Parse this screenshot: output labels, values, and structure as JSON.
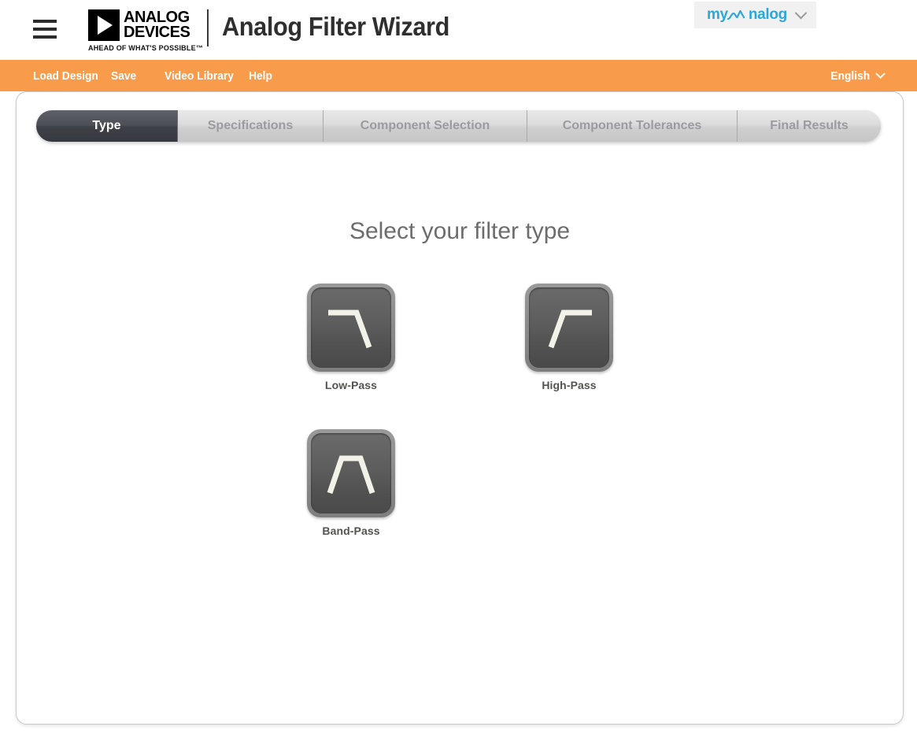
{
  "header": {
    "menu_icon": "hamburger-menu-icon",
    "brand": {
      "line1": "ANALOG",
      "line2": "DEVICES",
      "tagline": "AHEAD OF WHAT'S POSSIBLE™"
    },
    "app_title": "Analog Filter Wizard",
    "account": {
      "label_pre": "my",
      "label_post": "nalog",
      "full_label": "myAnalog",
      "chevron": "chevron-down-icon"
    }
  },
  "menubar": {
    "background": "#f89b4b",
    "items": [
      {
        "label": "Load Design",
        "name": "load-design"
      },
      {
        "label": "Save",
        "name": "save"
      },
      {
        "label": "Video Library",
        "name": "video-library"
      },
      {
        "label": "Help",
        "name": "help"
      }
    ],
    "language": {
      "label": "English",
      "chevron": "chevron-down-icon"
    }
  },
  "wizard": {
    "tabs": [
      {
        "label": "Type",
        "active": true
      },
      {
        "label": "Specifications",
        "active": false
      },
      {
        "label": "Component Selection",
        "active": false
      },
      {
        "label": "Component Tolerances",
        "active": false
      },
      {
        "label": "Final Results",
        "active": false
      }
    ],
    "heading": "Select your filter type",
    "filter_types": [
      {
        "label": "Low-Pass",
        "icon": "low-pass-response-icon"
      },
      {
        "label": "High-Pass",
        "icon": "high-pass-response-icon"
      },
      {
        "label": "Band-Pass",
        "icon": "band-pass-response-icon"
      }
    ]
  },
  "colors": {
    "accent_orange": "#f89b4b",
    "brand_cyan": "#2aa8d8",
    "active_tab": "#45474f",
    "inactive_tab_text": "#9b9ba1",
    "heading_gray": "#6d6d6d",
    "label_gray": "#53534f"
  }
}
